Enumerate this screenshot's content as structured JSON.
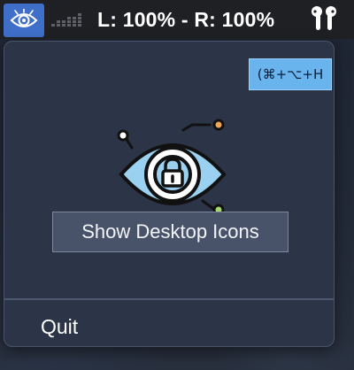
{
  "menubar": {
    "app_icon": "eye-outline-icon",
    "equalizer_icon": "volume-bars-icon",
    "volume_text": "L: 100% - R: 100%",
    "device_icon": "airpods-icon",
    "accent_color": "#3f6fc9"
  },
  "menu": {
    "shortcut": "(⌘+⌥+H",
    "hero_icon": "eye-lock-circuit-icon",
    "show_button": "Show Desktop Icons",
    "quit_label": "Quit"
  },
  "colors": {
    "panel_bg": "#2c3547",
    "shortcut_bg": "#6ab4ee",
    "button_bg": "#48536a"
  }
}
